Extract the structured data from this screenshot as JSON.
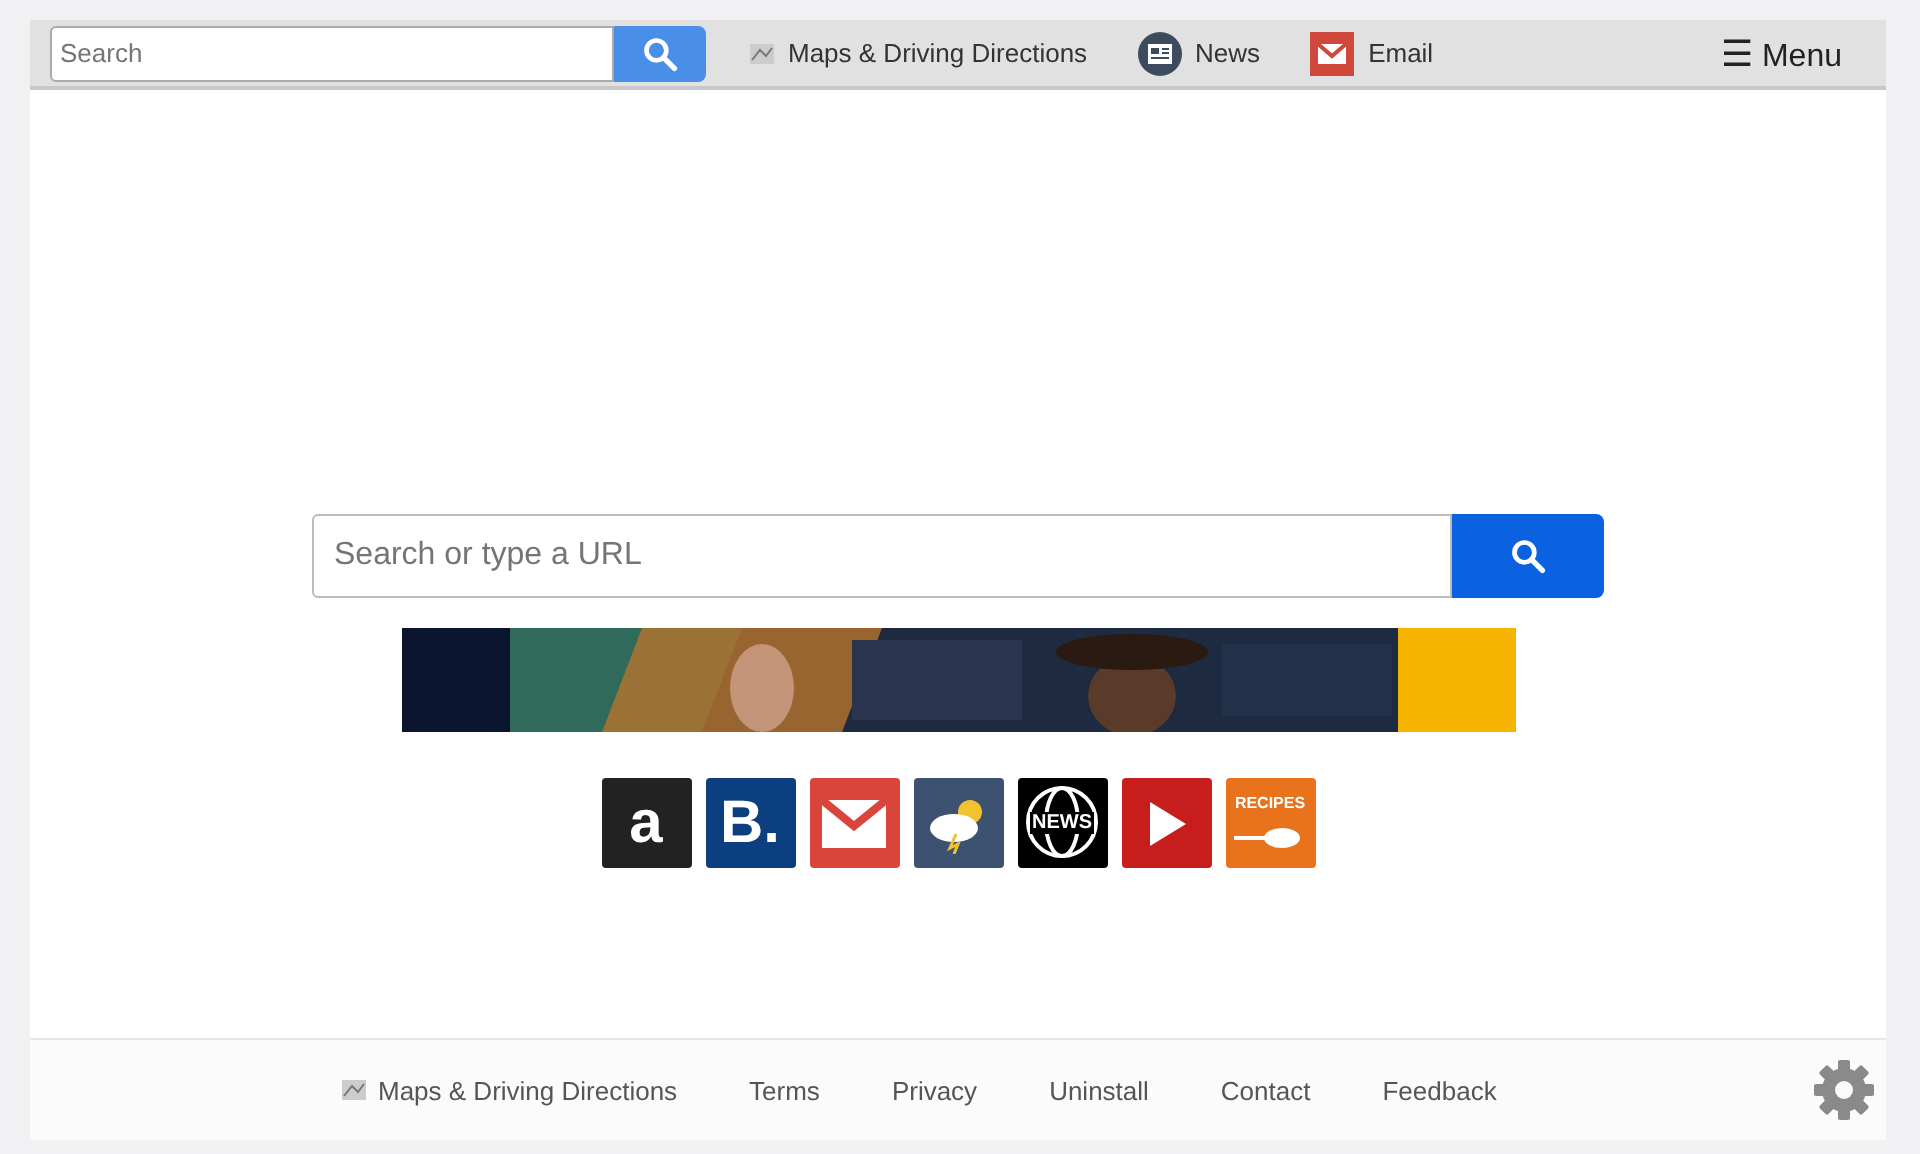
{
  "topbar": {
    "search": {
      "placeholder": "Search"
    },
    "links": [
      {
        "kind": "map",
        "label": "Maps & Driving Directions"
      },
      {
        "kind": "news",
        "label": "News"
      },
      {
        "kind": "mail",
        "label": "Email"
      }
    ],
    "menu": {
      "icon": "☰",
      "label": "Menu"
    }
  },
  "main_search": {
    "placeholder": "Search or type a URL"
  },
  "tiles": [
    {
      "kind": "letter",
      "text": "a",
      "color": "#222222"
    },
    {
      "kind": "letter",
      "text": "B.",
      "color": "#0b3f7f"
    },
    {
      "kind": "mail",
      "color": "#d9453a"
    },
    {
      "kind": "weather",
      "color": "#3c5270"
    },
    {
      "kind": "globe",
      "text": "NEWS",
      "color": "#000000"
    },
    {
      "kind": "play",
      "color": "#c81d1d"
    },
    {
      "kind": "recipes",
      "text": "RECIPES",
      "color": "#e8731c"
    }
  ],
  "footer": {
    "links": [
      {
        "kind": "map",
        "label": "Maps & Driving Directions"
      },
      {
        "label": "Terms"
      },
      {
        "label": "Privacy"
      },
      {
        "label": "Uninstall"
      },
      {
        "label": "Contact"
      },
      {
        "label": "Feedback"
      }
    ]
  }
}
